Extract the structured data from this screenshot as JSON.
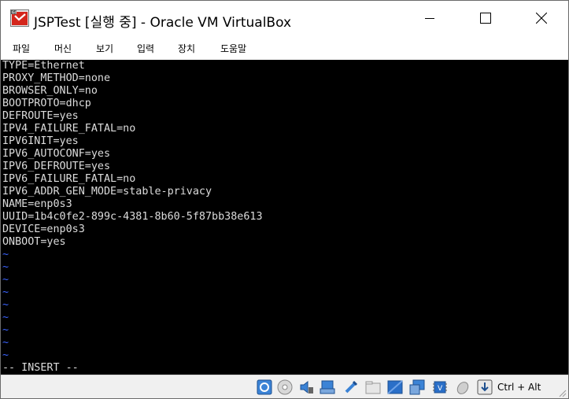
{
  "window": {
    "title": "JSPTest [실행 중] - Oracle VM VirtualBox",
    "app_icon": "virtualbox-vm-icon",
    "controls": [
      "minimize-icon",
      "maximize-icon",
      "close-icon"
    ]
  },
  "menu": {
    "items": [
      {
        "label": "파일"
      },
      {
        "label": "머신"
      },
      {
        "label": "보기"
      },
      {
        "label": "입력"
      },
      {
        "label": "장치"
      },
      {
        "label": "도움말"
      }
    ]
  },
  "terminal": {
    "lines": [
      "TYPE=Ethernet",
      "PROXY_METHOD=none",
      "BROWSER_ONLY=no",
      "BOOTPROTO=dhcp",
      "DEFROUTE=yes",
      "IPV4_FAILURE_FATAL=no",
      "IPV6INIT=yes",
      "IPV6_AUTOCONF=yes",
      "IPV6_DEFROUTE=yes",
      "IPV6_FAILURE_FATAL=no",
      "IPV6_ADDR_GEN_MODE=stable-privacy",
      "NAME=enp0s3",
      "UUID=1b4c0fe2-899c-4381-8b60-5f87bb38e613",
      "DEVICE=enp0s3",
      "ONBOOT=yes"
    ],
    "filler": [
      "~",
      "~",
      "~",
      "~",
      "~",
      "~",
      "~",
      "~",
      "~"
    ],
    "mode_line": "-- INSERT --",
    "colors": {
      "background": "#000000",
      "text": "#dcdcdc",
      "tilde": "#3b63ff"
    }
  },
  "statusbar": {
    "icons": [
      "hard-disk-icon",
      "optical-drive-icon",
      "audio-icon",
      "network-icon",
      "usb-icon",
      "shared-folders-icon",
      "display-icon",
      "video-capture-icon",
      "virtualization-engine-icon",
      "mouse-integration-icon",
      "keyboard-capture-icon"
    ],
    "host_key": "Ctrl + Alt"
  }
}
